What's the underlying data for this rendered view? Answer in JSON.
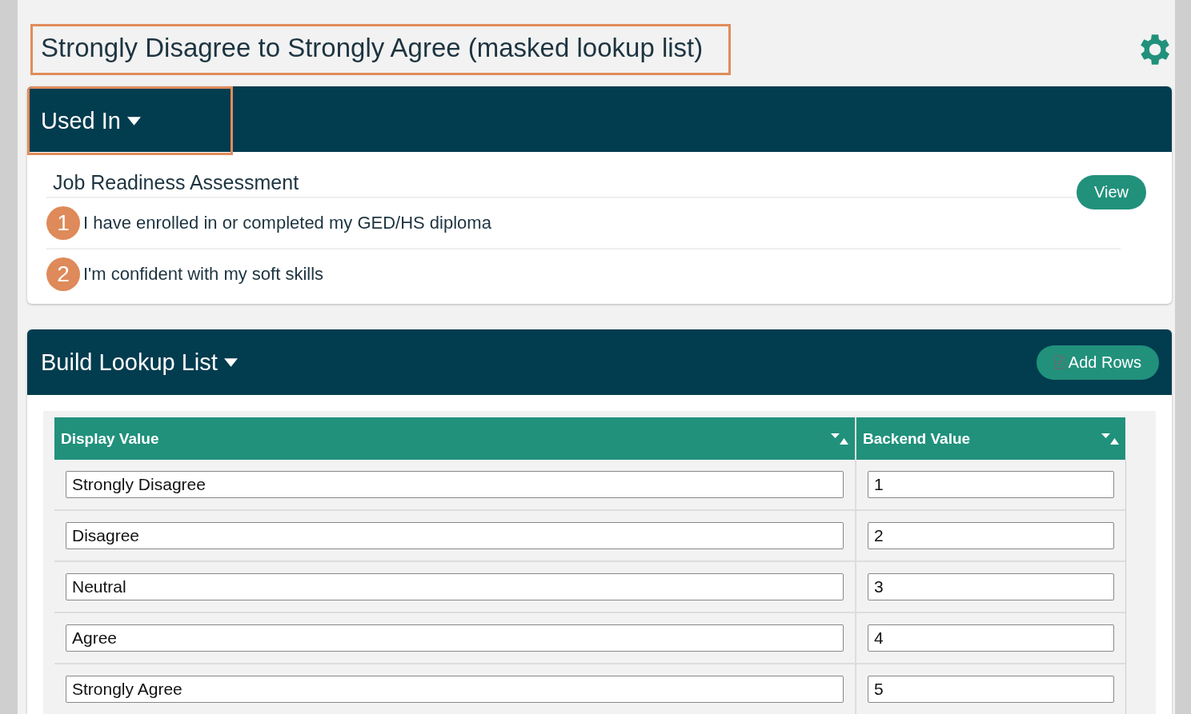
{
  "title": {
    "text": "Strongly Disagree to Strongly Agree (masked lookup list)",
    "highlighted": true
  },
  "used_in": {
    "label": "Used In",
    "highlighted": true,
    "form": {
      "name": "Job Readiness Assessment",
      "button": "View"
    },
    "questions": [
      {
        "number": "1",
        "text": "I have enrolled in or completed my GED/HS diploma"
      },
      {
        "number": "2",
        "text": "I'm confident with my soft skills"
      }
    ]
  },
  "build": {
    "label": "Build Lookup List",
    "button": "Add Rows"
  },
  "table": {
    "columns": [
      {
        "label": "Display Value"
      },
      {
        "label": "Backend Value"
      }
    ],
    "rows": [
      {
        "display": "Strongly Disagree",
        "backend": "1"
      },
      {
        "display": "Disagree",
        "backend": "2"
      },
      {
        "display": "Neutral",
        "backend": "3"
      },
      {
        "display": "Agree",
        "backend": "4"
      },
      {
        "display": "Strongly Agree",
        "backend": "5"
      }
    ]
  }
}
